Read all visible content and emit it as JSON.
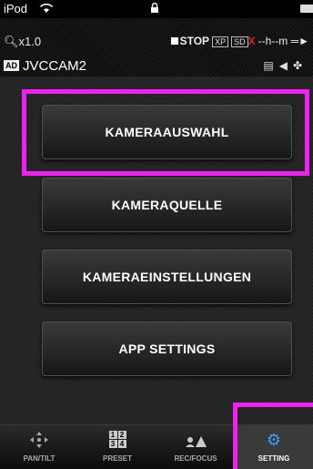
{
  "status_bar": {
    "carrier": "iPod",
    "wifi": "wifi-icon",
    "lock": "lock-icon",
    "battery": "battery-icon"
  },
  "info_bar": {
    "zoom": "x1.0",
    "rec_status": "STOP",
    "format_badge": "XP",
    "sd_badge": "SD",
    "sd_error": "X",
    "timecode": "--h--m",
    "camera_badge": "AD",
    "camera_name": "JVCCAM2"
  },
  "menu": {
    "items": [
      {
        "label": "KAMERAAUSWAHL"
      },
      {
        "label": "KAMERAQUELLE"
      },
      {
        "label": "KAMERAEINSTELLUNGEN"
      },
      {
        "label": "APP SETTINGS"
      }
    ]
  },
  "tabs": [
    {
      "label": "PAN/TILT",
      "icon": "pan-tilt-icon"
    },
    {
      "label": "PRESET",
      "icon": "preset-grid-icon",
      "digits": [
        "1",
        "2",
        "3",
        "4"
      ]
    },
    {
      "label": "REC/FOCUS",
      "icon": "rec-focus-icon"
    },
    {
      "label": "SETTING",
      "icon": "gear-icon",
      "active": true
    }
  ],
  "colors": {
    "highlight": "#ee22ee",
    "active_tab_icon": "#3aa0ff",
    "sd_error": "#e02020"
  }
}
